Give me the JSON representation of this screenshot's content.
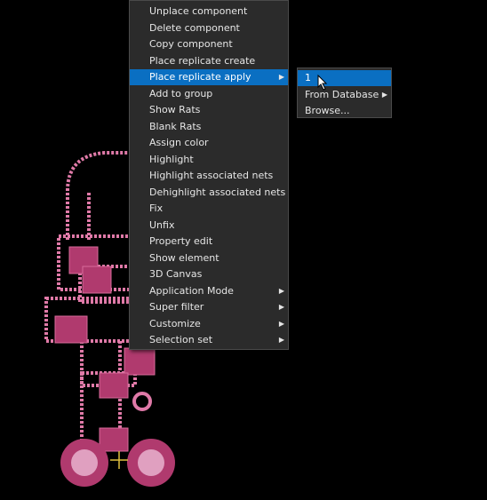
{
  "context_menu": {
    "items": [
      {
        "label": "Unplace component",
        "has_submenu": false
      },
      {
        "label": "Delete component",
        "has_submenu": false
      },
      {
        "label": "Copy component",
        "has_submenu": false
      },
      {
        "label": "Place replicate create",
        "has_submenu": false
      },
      {
        "label": "Place replicate apply",
        "has_submenu": true,
        "active": true
      },
      {
        "label": "Add to group",
        "has_submenu": false
      },
      {
        "label": "Show Rats",
        "has_submenu": false
      },
      {
        "label": "Blank Rats",
        "has_submenu": false
      },
      {
        "label": "Assign color",
        "has_submenu": false
      },
      {
        "label": "Highlight",
        "has_submenu": false
      },
      {
        "label": "Highlight associated nets",
        "has_submenu": false
      },
      {
        "label": "Dehighlight associated nets",
        "has_submenu": false
      },
      {
        "label": "Fix",
        "has_submenu": false
      },
      {
        "label": "Unfix",
        "has_submenu": false
      },
      {
        "label": "Property edit",
        "has_submenu": false
      },
      {
        "label": "Show element",
        "has_submenu": false
      },
      {
        "label": "3D Canvas",
        "has_submenu": false
      },
      {
        "label": "Application Mode",
        "has_submenu": true
      },
      {
        "label": "Super filter",
        "has_submenu": true
      },
      {
        "label": "Customize",
        "has_submenu": true
      },
      {
        "label": "Selection set",
        "has_submenu": true
      }
    ]
  },
  "submenu": {
    "items": [
      {
        "label": "1",
        "has_submenu": false,
        "active": true
      },
      {
        "label": "From Database",
        "has_submenu": true
      },
      {
        "label": "Browse...",
        "has_submenu": false
      }
    ]
  },
  "icons": {
    "submenu_arrow": "▶",
    "cursor": "arrow-cursor-icon"
  },
  "colors": {
    "background": "#000000",
    "menu_bg": "#2b2b2b",
    "highlight": "#0a6fc2",
    "trace_pink": "#e07aa8",
    "pad_pink": "#b03a6e"
  }
}
